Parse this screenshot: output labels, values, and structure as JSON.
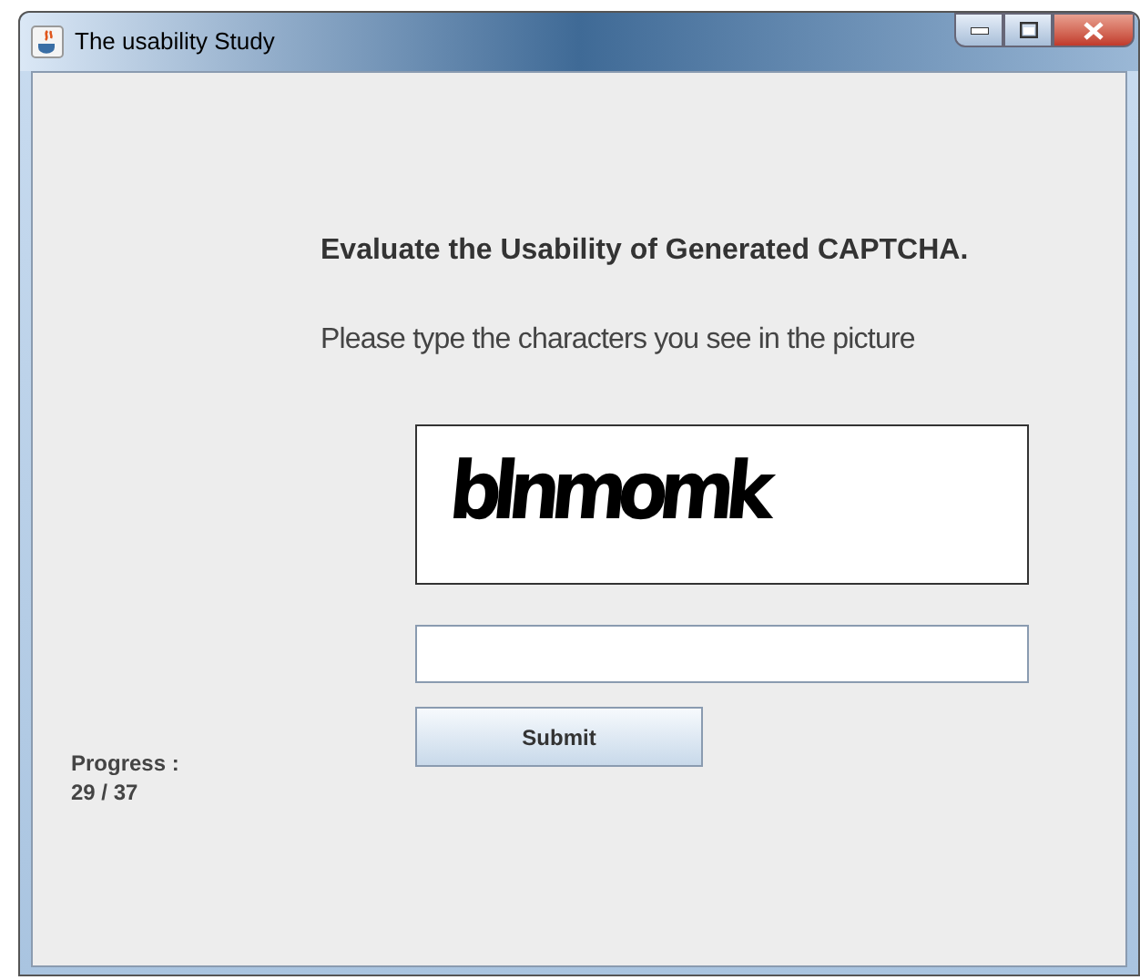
{
  "window": {
    "title": "The usability Study"
  },
  "heading": "Evaluate the Usability of Generated CAPTCHA.",
  "instruction": "Please type the characters you see in the picture",
  "captcha": {
    "text": "blnmomk"
  },
  "submit": {
    "label": "Submit"
  },
  "progress": {
    "label": "Progress :",
    "count": "29 / 37"
  }
}
